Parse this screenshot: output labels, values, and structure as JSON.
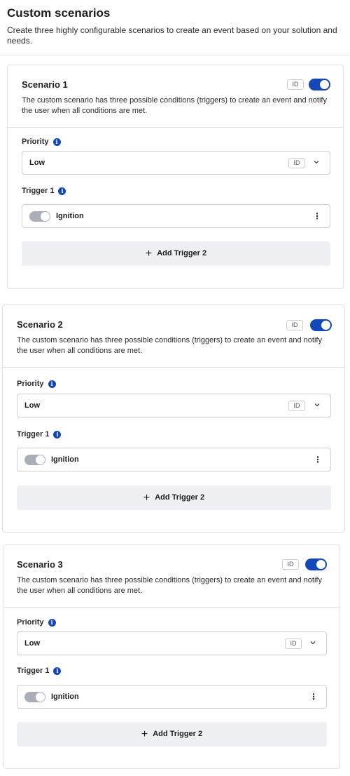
{
  "header": {
    "title": "Custom scenarios",
    "description": "Create three highly configurable scenarios to create an event based on your solution and needs."
  },
  "colors": {
    "accent": "#1447b8",
    "toggle_off": "#a9aeb8",
    "button_bg": "#eef0f3"
  },
  "scenarios": [
    {
      "title": "Scenario 1",
      "id_badge": "ID",
      "enabled": true,
      "description": "The custom scenario has three possible conditions (triggers) to create an event and notify the user when all conditions are met.",
      "priority_label": "Priority",
      "priority_value": "Low",
      "priority_id_badge": "ID",
      "trigger_label": "Trigger 1",
      "trigger_name": "Ignition",
      "trigger_enabled": true,
      "add_trigger_label": "Add Trigger 2"
    },
    {
      "title": "Scenario 2",
      "id_badge": "ID",
      "enabled": true,
      "description": "The custom scenario has three possible conditions (triggers) to create an event and notify the user when all conditions are met.",
      "priority_label": "Priority",
      "priority_value": "Low",
      "priority_id_badge": "ID",
      "trigger_label": "Trigger 1",
      "trigger_name": "Ignition",
      "trigger_enabled": true,
      "add_trigger_label": "Add Trigger 2"
    },
    {
      "title": "Scenario 3",
      "id_badge": "ID",
      "enabled": true,
      "description": "The custom scenario has three possible conditions (triggers) to create an event and notify the user when all conditions are met.",
      "priority_label": "Priority",
      "priority_value": "Low",
      "priority_id_badge": "ID",
      "trigger_label": "Trigger 1",
      "trigger_name": "Ignition",
      "trigger_enabled": true,
      "add_trigger_label": "Add Trigger 2"
    }
  ]
}
